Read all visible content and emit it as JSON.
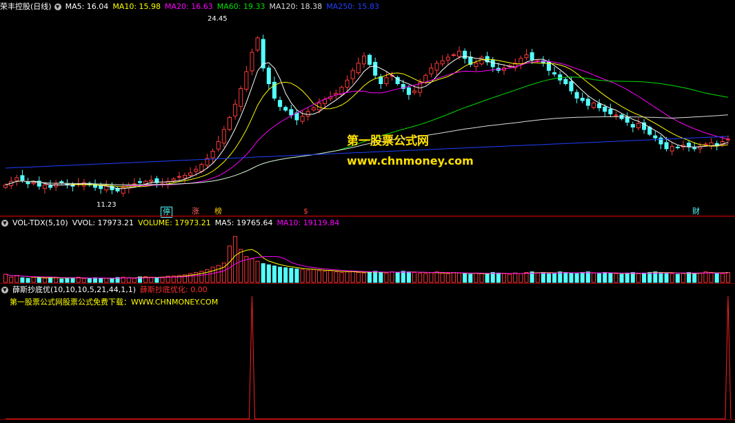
{
  "header_main": {
    "stock_name": "荣丰控股(日线)",
    "ma5": "MA5: 16.04",
    "ma10": "MA10: 15.98",
    "ma20": "MA20: 16.63",
    "ma60": "MA60: 19.33",
    "ma120": "MA120: 18.38",
    "ma250": "MA250: 15.83"
  },
  "header_vol": {
    "indicator": "VOL-TDX(5,10)",
    "vvol": "VVOL: 17973.21",
    "volume": "VOLUME: 17973.21",
    "ma5": "MA5: 19765.64",
    "ma10": "MA10: 19119.84"
  },
  "header_ind": {
    "indicator": "薛斯抄底优(10,10,10,5,21,44,1,1)",
    "value": "薛斯抄底优化: 0.00"
  },
  "sub_note": "第一股票公式网股票公式免费下载：WWW.CHNMONEY.COM",
  "watermark": {
    "title": "第一股票公式网",
    "url": "www.chnmoney.com"
  },
  "price_labels": {
    "high": "24.45",
    "low": "11.23"
  },
  "tags": {
    "t1": "停",
    "t2": "涨",
    "t3": "榜",
    "t4": "$",
    "t5": "财"
  },
  "colors": {
    "up": "#ff3a3a",
    "down": "#54ffff",
    "ma5": "#ffffff",
    "ma10": "#ffff00",
    "ma20": "#ff00ff",
    "ma60": "#00e000",
    "ma120": "#dddddd",
    "ma250": "#2040ff",
    "grid": "#8b0000"
  },
  "chart_data": [
    {
      "type": "candlestick",
      "title": "荣丰控股(日线)",
      "ylim": [
        10,
        26
      ],
      "annotations": [
        "24.45",
        "11.23"
      ],
      "close_series": [
        11.8,
        12.1,
        12.4,
        12.2,
        11.9,
        12.0,
        11.7,
        11.8,
        11.6,
        11.9,
        12.0,
        11.8,
        11.7,
        11.9,
        12.0,
        11.8,
        11.6,
        11.5,
        11.7,
        11.4,
        11.3,
        11.6,
        11.8,
        11.9,
        12.0,
        12.1,
        12.2,
        12.0,
        11.9,
        12.1,
        12.3,
        12.5,
        12.6,
        12.8,
        13.1,
        13.5,
        14.0,
        14.6,
        15.4,
        16.4,
        17.4,
        18.5,
        19.8,
        21.2,
        22.8,
        24.0,
        21.5,
        20.2,
        19.0,
        18.3,
        18.0,
        17.6,
        17.2,
        17.5,
        17.9,
        18.2,
        18.6,
        18.9,
        19.1,
        19.4,
        19.9,
        20.5,
        21.3,
        21.9,
        22.5,
        21.8,
        20.9,
        20.2,
        20.7,
        20.9,
        20.2,
        19.8,
        19.3,
        19.6,
        20.3,
        20.9,
        21.5,
        21.9,
        22.1,
        22.4,
        22.6,
        22.9,
        22.3,
        21.8,
        21.9,
        22.4,
        22.0,
        21.6,
        21.3,
        21.5,
        21.7,
        21.9,
        22.3,
        22.6,
        22.2,
        22.1,
        21.9,
        21.3,
        21.0,
        20.5,
        20.2,
        19.6,
        19.0,
        18.8,
        18.4,
        18.6,
        18.2,
        17.9,
        17.7,
        17.6,
        17.3,
        17.0,
        16.6,
        16.9,
        16.4,
        16.0,
        15.7,
        15.2,
        14.8,
        15.0,
        14.9,
        15.1,
        15.0,
        14.8,
        15.0,
        15.2,
        15.3,
        15.1,
        15.4,
        15.6
      ]
    },
    {
      "type": "bar",
      "title": "VOL-TDX(5,10)",
      "ylim": [
        0,
        90000
      ],
      "values": [
        14000,
        9000,
        12000,
        8000,
        7000,
        9000,
        8000,
        7500,
        9000,
        8000,
        6000,
        7500,
        8000,
        9000,
        7000,
        6500,
        8000,
        7000,
        7500,
        6000,
        8500,
        9000,
        8000,
        7000,
        9500,
        10000,
        9000,
        8500,
        8000,
        10500,
        11000,
        12000,
        13000,
        15000,
        17000,
        19000,
        22000,
        26000,
        29000,
        33000,
        62000,
        78000,
        56000,
        44000,
        40000,
        36000,
        32000,
        30000,
        28000,
        26000,
        25000,
        24000,
        23000,
        22000,
        21000,
        22000,
        20000,
        19000,
        20000,
        18000,
        17000,
        18000,
        19000,
        17000,
        16000,
        18000,
        19000,
        17000,
        16000,
        18000,
        17000,
        19000,
        18000,
        17000,
        16000,
        15000,
        17000,
        18000,
        16000,
        15000,
        17000,
        16000,
        15000,
        14000,
        16000,
        15000,
        14000,
        17000,
        16000,
        15000,
        14000,
        16000,
        15000,
        17000,
        18000,
        16000,
        17000,
        15000,
        16000,
        18000,
        17000,
        16000,
        15000,
        17000,
        18000,
        16000,
        15000,
        17000,
        16000,
        15000,
        14000,
        16000,
        17000,
        15000,
        16000,
        17000,
        18000,
        17000,
        16000,
        15000,
        14000,
        16000,
        17000,
        15000,
        16000,
        18000,
        17000,
        16000,
        15000,
        17000
      ]
    },
    {
      "type": "line",
      "title": "薛斯抄底优(10,10,10,5,21,44,1,1)",
      "ylim": [
        0,
        1
      ],
      "spikes_at": [
        44,
        129
      ],
      "value_latest": "0.00"
    }
  ]
}
